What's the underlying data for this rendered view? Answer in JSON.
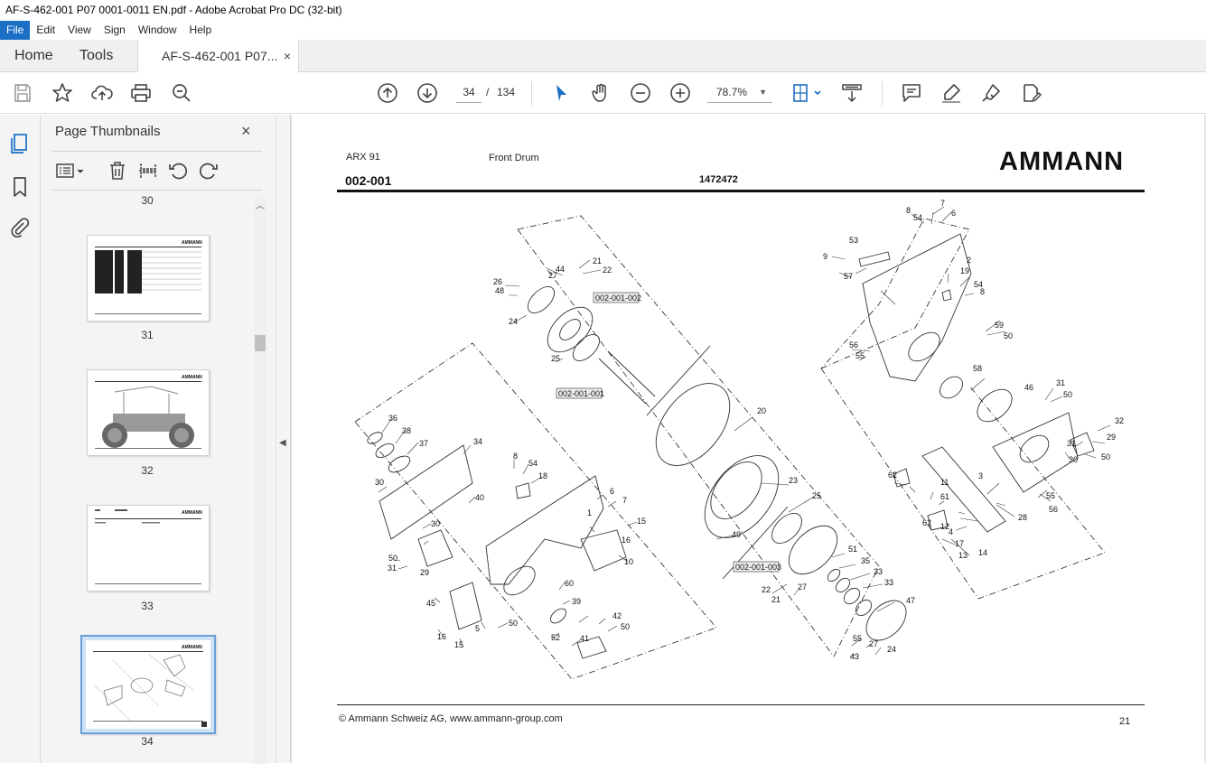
{
  "window": {
    "title": "AF-S-462-001 P07 0001-0011 EN.pdf - Adobe Acrobat Pro DC (32-bit)"
  },
  "menu": {
    "items": [
      "File",
      "Edit",
      "View",
      "Sign",
      "Window",
      "Help"
    ]
  },
  "tabs": {
    "home": "Home",
    "tools": "Tools",
    "document": "AF-S-462-001 P07...",
    "close": "×"
  },
  "toolbar": {
    "current_page": "34",
    "separator": "/",
    "total_pages": "134",
    "zoom": "78.7%"
  },
  "thumbnails_panel": {
    "title": "Page Thumbnails",
    "close": "×",
    "pages": [
      "30",
      "31",
      "32",
      "33",
      "34"
    ],
    "selected_page": "34"
  },
  "page": {
    "model": "ARX 91",
    "title": "Front Drum",
    "code": "002-001",
    "part_number": "1472472",
    "logo": "AMMANN",
    "copyright": "© Ammann Schweiz AG, www.ammann-group.com",
    "page_number": "21",
    "subassembly_refs": [
      "002-001-002",
      "002-001-001",
      "002-001-003"
    ],
    "callouts": [
      "8",
      "7",
      "54",
      "6",
      "2",
      "9",
      "53",
      "57",
      "19",
      "54",
      "8",
      "56",
      "55",
      "59",
      "50",
      "58",
      "46",
      "31",
      "50",
      "32",
      "29",
      "31",
      "30",
      "50",
      "55",
      "56",
      "3",
      "62",
      "11",
      "61",
      "12",
      "62",
      "4",
      "28",
      "17",
      "14",
      "13",
      "26",
      "44",
      "21",
      "22",
      "27",
      "48",
      "24",
      "25",
      "20",
      "23",
      "25",
      "49",
      "51",
      "35",
      "33",
      "33",
      "47",
      "22",
      "27",
      "21",
      "55",
      "27",
      "24",
      "43",
      "36",
      "38",
      "37",
      "34",
      "30",
      "40",
      "30",
      "50",
      "31",
      "29",
      "8",
      "54",
      "18",
      "6",
      "7",
      "15",
      "1",
      "16",
      "10",
      "60",
      "39",
      "42",
      "50",
      "52",
      "41",
      "45",
      "16",
      "15",
      "5",
      "50",
      "31"
    ]
  },
  "colors": {
    "accent": "#1a6ec4",
    "selection_border": "#6a9fd8"
  }
}
